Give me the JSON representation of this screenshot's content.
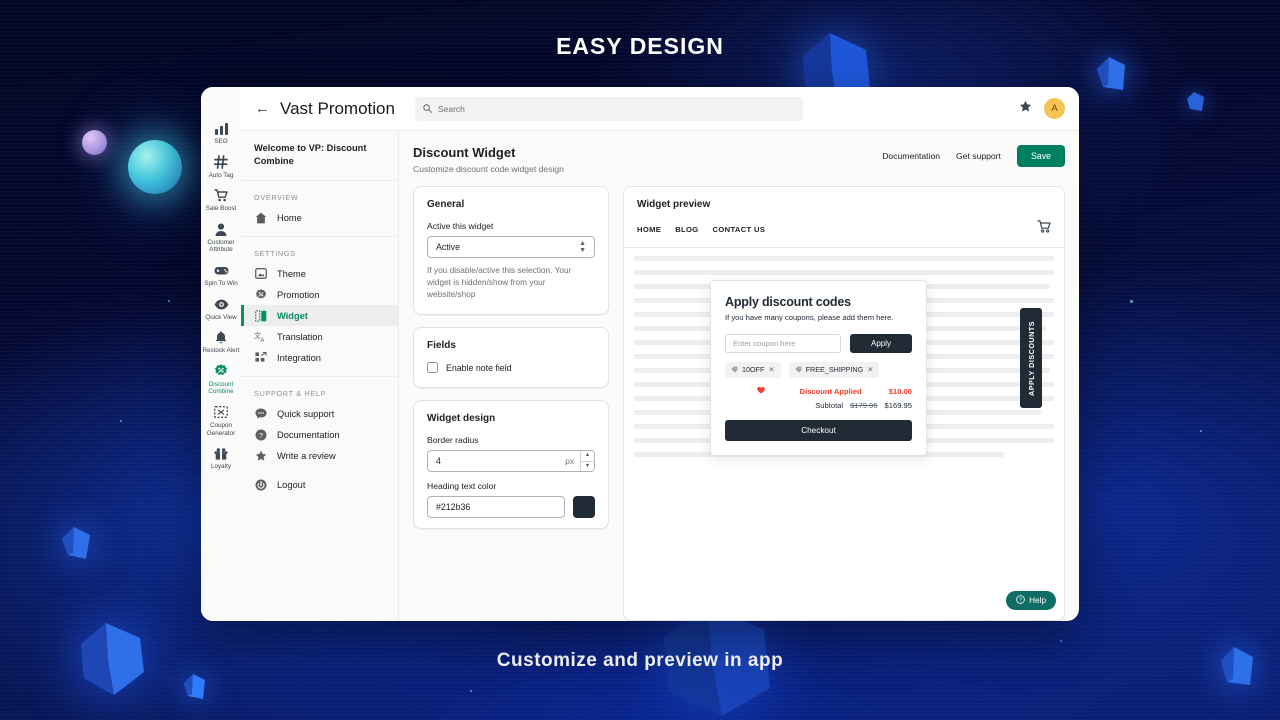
{
  "banner": {
    "top": "EASY DESIGN",
    "bottom": "Customize and preview in app"
  },
  "colors": {
    "brand_green": "#008060",
    "active_green": "#0a8f5f",
    "dark_navy": "#212b36",
    "discount_red": "#fa3b2a",
    "help_teal": "#0e6e63",
    "avatar_yellow": "#f5c451"
  },
  "rail": {
    "items": [
      {
        "label": "SEO",
        "icon": "bar-chart-icon",
        "active": false
      },
      {
        "label": "Auto Tag",
        "icon": "hash-icon",
        "active": false
      },
      {
        "label": "Sale Boost",
        "icon": "cart-icon",
        "active": false
      },
      {
        "label": "Customer Attribute",
        "icon": "person-icon",
        "active": false
      },
      {
        "label": "Spin To Win",
        "icon": "gamepad-icon",
        "active": false
      },
      {
        "label": "Quick View",
        "icon": "eye-icon",
        "active": false
      },
      {
        "label": "Restock Alert",
        "icon": "bell-icon",
        "active": false
      },
      {
        "label": "Discount Combine",
        "icon": "discount-badge-icon",
        "active": true
      },
      {
        "label": "Coupon Generator",
        "icon": "coupon-icon",
        "active": false
      },
      {
        "label": "Loyalty",
        "icon": "gift-icon",
        "active": false
      }
    ]
  },
  "topbar": {
    "back_icon": "back-arrow-icon",
    "brand": "Vast Promotion",
    "search_placeholder": "Search",
    "search_value": "",
    "star_icon": "star-icon",
    "avatar_initial": "A"
  },
  "nav": {
    "welcome": "Welcome to VP: Discount Combine",
    "sections": [
      {
        "title": "OVERVIEW",
        "items": [
          {
            "label": "Home",
            "icon": "home-icon",
            "active": false
          }
        ]
      },
      {
        "title": "SETTINGS",
        "items": [
          {
            "label": "Theme",
            "icon": "theme-icon",
            "active": false
          },
          {
            "label": "Promotion",
            "icon": "promotion-badge-icon",
            "active": false
          },
          {
            "label": "Widget",
            "icon": "widget-icon",
            "active": true
          },
          {
            "label": "Translation",
            "icon": "translation-icon",
            "active": false
          },
          {
            "label": "Integration",
            "icon": "integration-icon",
            "active": false
          }
        ]
      },
      {
        "title": "SUPPORT & HELP",
        "items": [
          {
            "label": "Quick support",
            "icon": "chat-icon",
            "active": false
          },
          {
            "label": "Documentation",
            "icon": "question-circle-icon",
            "active": false
          },
          {
            "label": "Write a review",
            "icon": "star-icon",
            "active": false
          },
          {
            "label": "Logout",
            "icon": "logout-icon",
            "active": false
          }
        ]
      }
    ]
  },
  "page": {
    "title": "Discount Widget",
    "subtitle": "Customize discount code widget design",
    "documentation_label": "Documentation",
    "get_support_label": "Get support",
    "save_label": "Save"
  },
  "general_card": {
    "title": "General",
    "active_label": "Active this widget",
    "active_value": "Active",
    "helper": "If you disable/active this selection. Your widget is hidden/show from your website/shop"
  },
  "fields_card": {
    "title": "Fields",
    "note_field_label": "Enable note field",
    "note_field_checked": false
  },
  "design_card": {
    "title": "Widget design",
    "border_radius_label": "Border radius",
    "border_radius_value": "4",
    "border_radius_unit": "px",
    "heading_color_label": "Heading text color",
    "heading_color_value": "#212b36"
  },
  "preview": {
    "title": "Widget preview",
    "nav_links": [
      "HOME",
      "BLOG",
      "CONTACT US"
    ],
    "cart_icon": "cart-icon",
    "apply_tab_label": "APPLY DISCOUNTS",
    "help_label": "Help",
    "help_icon": "question-circle-icon",
    "popup": {
      "title": "Apply discount codes",
      "subtitle": "If you have many coupons, please add them here.",
      "input_placeholder": "Enter coupon here",
      "input_value": "",
      "apply_label": "Apply",
      "chips": [
        "10OFF",
        "FREE_SHIPPING"
      ],
      "discount_label": "Discount Applied",
      "discount_amount": "$10.00",
      "subtotal_label": "Subtotal",
      "subtotal_original": "$179.95",
      "subtotal_final": "$169.95",
      "checkout_label": "Checkout"
    }
  }
}
